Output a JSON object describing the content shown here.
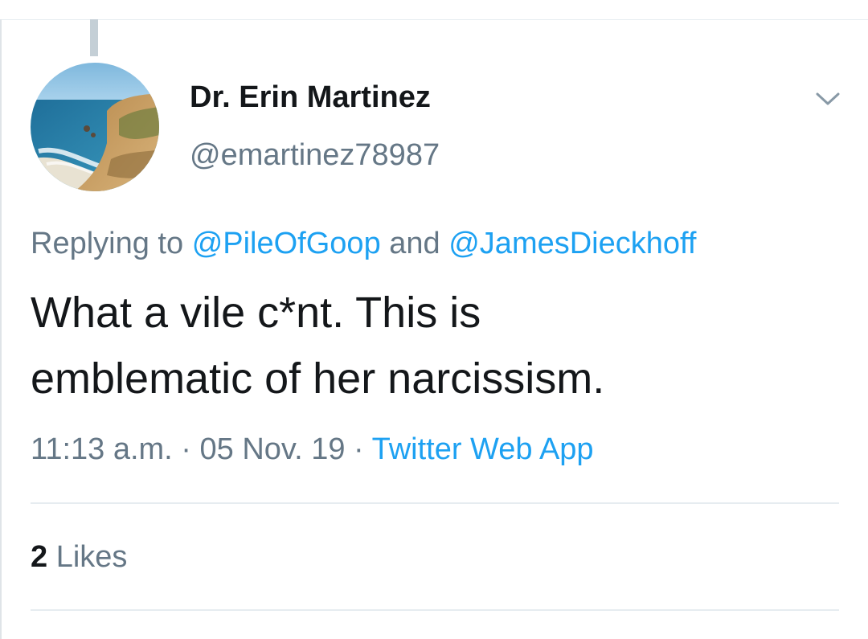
{
  "tweet": {
    "author": {
      "display_name": "Dr. Erin Martinez",
      "handle": "@emartinez78987",
      "avatar_description": "beach-coastline-photo"
    },
    "reply_context": {
      "prefix": "Replying to",
      "mentions": [
        "@PileOfGoop",
        "@JamesDieckhoff"
      ],
      "conjunction": "and"
    },
    "text_lines": [
      "What a vile c*nt. This is",
      "emblematic of her narcissism."
    ],
    "time": "11:13 a.m.",
    "separator": "·",
    "date": "05 Nov. 19",
    "source": "Twitter Web App",
    "likes": {
      "count": "2",
      "label": "Likes"
    },
    "menu_icon": "chevron-down-icon"
  },
  "colors": {
    "accent": "#1da1f2",
    "primary_text": "#14171a",
    "secondary_text": "#657786",
    "divider": "#e6ecf0",
    "thread_line": "#c4cfd6"
  }
}
